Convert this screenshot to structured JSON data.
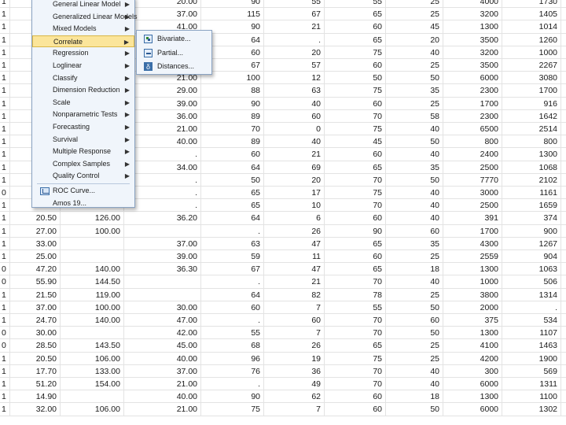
{
  "grid": {
    "rows": [
      [
        "1",
        "",
        "",
        "20.00",
        "90",
        "55",
        "55",
        "25",
        "4000",
        "1730"
      ],
      [
        "1",
        "",
        "",
        "37.00",
        "115",
        "67",
        "65",
        "25",
        "3200",
        "1405"
      ],
      [
        "1",
        "",
        "",
        "41.00",
        "90",
        "21",
        "60",
        "45",
        "1300",
        "1014"
      ],
      [
        "1",
        "",
        "",
        "",
        "64",
        ".",
        "65",
        "20",
        "3500",
        "1260"
      ],
      [
        "1",
        "",
        "",
        "30.00",
        "60",
        "20",
        "75",
        "40",
        "3200",
        "1000"
      ],
      [
        "1",
        "",
        "",
        "24.00",
        "67",
        "57",
        "60",
        "25",
        "3500",
        "2267"
      ],
      [
        "1",
        "",
        "",
        "21.00",
        "100",
        "12",
        "50",
        "50",
        "6000",
        "3080"
      ],
      [
        "1",
        "",
        "",
        "29.00",
        "88",
        "63",
        "75",
        "35",
        "2300",
        "1700"
      ],
      [
        "1",
        "",
        "",
        "39.00",
        "90",
        "40",
        "60",
        "25",
        "1700",
        "916"
      ],
      [
        "1",
        "",
        "",
        "36.00",
        "89",
        "60",
        "70",
        "58",
        "2300",
        "1642"
      ],
      [
        "1",
        "",
        "",
        "21.00",
        "70",
        "0",
        "75",
        "40",
        "6500",
        "2514"
      ],
      [
        "1",
        "",
        "",
        "40.00",
        "89",
        "40",
        "45",
        "50",
        "800",
        "800"
      ],
      [
        "1",
        "",
        "",
        ".",
        "60",
        "21",
        "60",
        "40",
        "2400",
        "1300"
      ],
      [
        "1",
        "",
        "",
        "34.00",
        "64",
        "69",
        "65",
        "35",
        "2500",
        "1068"
      ],
      [
        "1",
        "",
        "",
        ".",
        "50",
        "20",
        "70",
        "50",
        "7770",
        "2102"
      ],
      [
        "0",
        "",
        "",
        ".",
        "65",
        "17",
        "75",
        "40",
        "3000",
        "1161"
      ],
      [
        "1",
        "27.50",
        "142.00",
        ".",
        "65",
        "10",
        "70",
        "40",
        "2500",
        "1659"
      ],
      [
        "1",
        "20.50",
        "126.00",
        "36.20",
        "64",
        "6",
        "60",
        "40",
        "391",
        "374"
      ],
      [
        "1",
        "27.00",
        "100.00",
        "",
        ".",
        "26",
        "90",
        "60",
        "1700",
        "900"
      ],
      [
        "1",
        "33.00",
        "",
        "37.00",
        "63",
        "47",
        "65",
        "35",
        "4300",
        "1267"
      ],
      [
        "1",
        "25.00",
        "",
        "39.00",
        "59",
        "11",
        "60",
        "25",
        "2559",
        "904"
      ],
      [
        "0",
        "47.20",
        "140.00",
        "36.30",
        "67",
        "47",
        "65",
        "18",
        "1300",
        "1063"
      ],
      [
        "0",
        "55.90",
        "144.50",
        "",
        ".",
        "21",
        "70",
        "40",
        "1000",
        "506"
      ],
      [
        "1",
        "21.50",
        "119.00",
        "",
        "64",
        "82",
        "78",
        "25",
        "3800",
        "1314"
      ],
      [
        "1",
        "37.00",
        "100.00",
        "30.00",
        "60",
        "7",
        "55",
        "50",
        "2000",
        "."
      ],
      [
        "1",
        "24.70",
        "140.00",
        "47.00",
        ".",
        "60",
        "70",
        "60",
        "375",
        "534"
      ],
      [
        "0",
        "30.00",
        "",
        "42.00",
        "55",
        "7",
        "70",
        "50",
        "1300",
        "1107"
      ],
      [
        "0",
        "28.50",
        "143.50",
        "45.00",
        "68",
        "26",
        "65",
        "25",
        "4100",
        "1463"
      ],
      [
        "1",
        "20.50",
        "106.00",
        "40.00",
        "96",
        "19",
        "75",
        "25",
        "4200",
        "1900"
      ],
      [
        "1",
        "17.70",
        "133.00",
        "37.00",
        "76",
        "36",
        "70",
        "40",
        "300",
        "569"
      ],
      [
        "1",
        "51.20",
        "154.00",
        "21.00",
        ".",
        "49",
        "70",
        "40",
        "6000",
        "1311"
      ],
      [
        "1",
        "14.90",
        "",
        "40.00",
        "90",
        "62",
        "60",
        "18",
        "1300",
        "1100"
      ],
      [
        "1",
        "32.00",
        "106.00",
        "21.00",
        "75",
        "7",
        "60",
        "50",
        "6000",
        "1302"
      ]
    ]
  },
  "analyze_menu": {
    "items": [
      {
        "label": "General Linear Model",
        "submenu": true
      },
      {
        "label": "Generalized Linear Models",
        "submenu": true
      },
      {
        "label": "Mixed Models",
        "submenu": true
      },
      {
        "label": "Correlate",
        "submenu": true,
        "active": true
      },
      {
        "label": "Regression",
        "submenu": true
      },
      {
        "label": "Loglinear",
        "submenu": true
      },
      {
        "label": "Classify",
        "submenu": true
      },
      {
        "label": "Dimension Reduction",
        "submenu": true
      },
      {
        "label": "Scale",
        "submenu": true
      },
      {
        "label": "Nonparametric Tests",
        "submenu": true
      },
      {
        "label": "Forecasting",
        "submenu": true
      },
      {
        "label": "Survival",
        "submenu": true
      },
      {
        "label": "Multiple Response",
        "submenu": true
      },
      {
        "label": "Complex Samples",
        "submenu": true
      },
      {
        "label": "Quality Control",
        "submenu": true
      },
      {
        "label": "ROC Curve...",
        "submenu": false,
        "icon": "roc-curve-icon",
        "separator_before": true
      },
      {
        "label": "Amos 19...",
        "submenu": false
      }
    ]
  },
  "correlate_submenu": {
    "items": [
      {
        "label": "Bivariate...",
        "icon": "bivariate-icon"
      },
      {
        "label": "Partial...",
        "icon": "partial-icon"
      },
      {
        "label": "Distances...",
        "icon": "distances-icon"
      }
    ]
  },
  "colors": {
    "menu_background": "#f0f5fb",
    "menu_border": "#8aa3c2",
    "highlight": "#fbe59a",
    "grid_line": "#e3e3e3"
  }
}
